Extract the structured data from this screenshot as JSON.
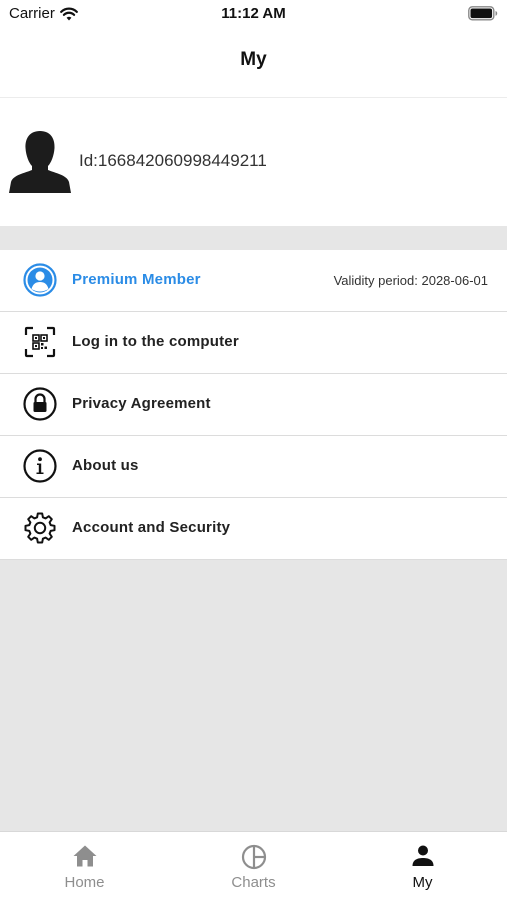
{
  "status_bar": {
    "carrier": "Carrier",
    "time": "11:12 AM",
    "wifi_icon": "wifi-icon",
    "battery_icon": "battery-full-icon"
  },
  "nav": {
    "title": "My"
  },
  "profile": {
    "avatar_icon": "user-silhouette-icon",
    "id_text": "Id:16684206099844921​1"
  },
  "menu": {
    "items": [
      {
        "label": "Premium Member",
        "icon": "user-circle-icon",
        "right_text": "Validity period: 2028-06-01"
      },
      {
        "label": "Log in to the computer",
        "icon": "qr-scan-icon"
      },
      {
        "label": "Privacy Agreement",
        "icon": "lock-icon"
      },
      {
        "label": "About us",
        "icon": "info-icon"
      },
      {
        "label": "Account and Security",
        "icon": "gear-icon"
      }
    ]
  },
  "tab_bar": {
    "tabs": [
      {
        "label": "Home",
        "icon": "home-icon",
        "active": false
      },
      {
        "label": "Charts",
        "icon": "pie-chart-icon",
        "active": false
      },
      {
        "label": "My",
        "icon": "person-icon",
        "active": true
      }
    ]
  },
  "colors": {
    "accent": "#2b8ce6",
    "background": "#e6e6e6",
    "inactive_tab": "#8e8e8e"
  }
}
